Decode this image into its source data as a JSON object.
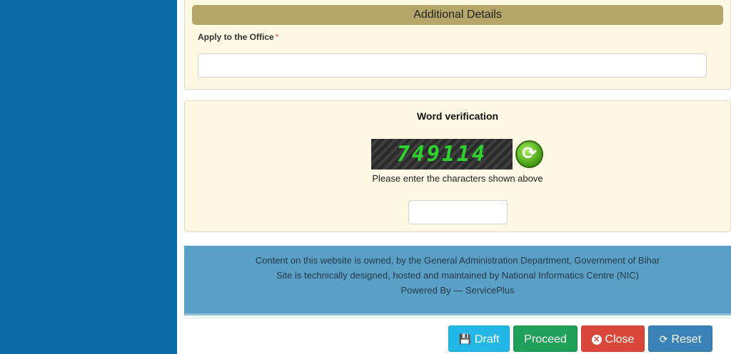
{
  "additional_details": {
    "header": "Additional Details",
    "office_label": "Apply to the Office",
    "required_mark": "*",
    "office_value": ""
  },
  "word_verification": {
    "title": "Word verification",
    "captcha_text": "749114",
    "refresh_icon": "refresh-icon",
    "hint": "Please enter the characters shown above",
    "input_value": ""
  },
  "footer": {
    "line1": "Content on this website is owned, by the General Administration Department, Government of Bihar",
    "line2": "Site is technically designed, hosted and maintained by National Informatics Centre (NIC)",
    "line3": "Powered By — ServicePlus"
  },
  "actions": {
    "draft": "Draft",
    "proceed": "Proceed",
    "close": "Close",
    "reset": "Reset"
  },
  "colors": {
    "sidebar": "#0a6aa5",
    "panel_bg": "#fdf8e3",
    "header_bar": "#b5a769",
    "footer_bg": "#5aa0c6",
    "draft": "#23b7e5",
    "proceed": "#1fa15a",
    "close": "#d9473b",
    "reset": "#3a82b7"
  }
}
